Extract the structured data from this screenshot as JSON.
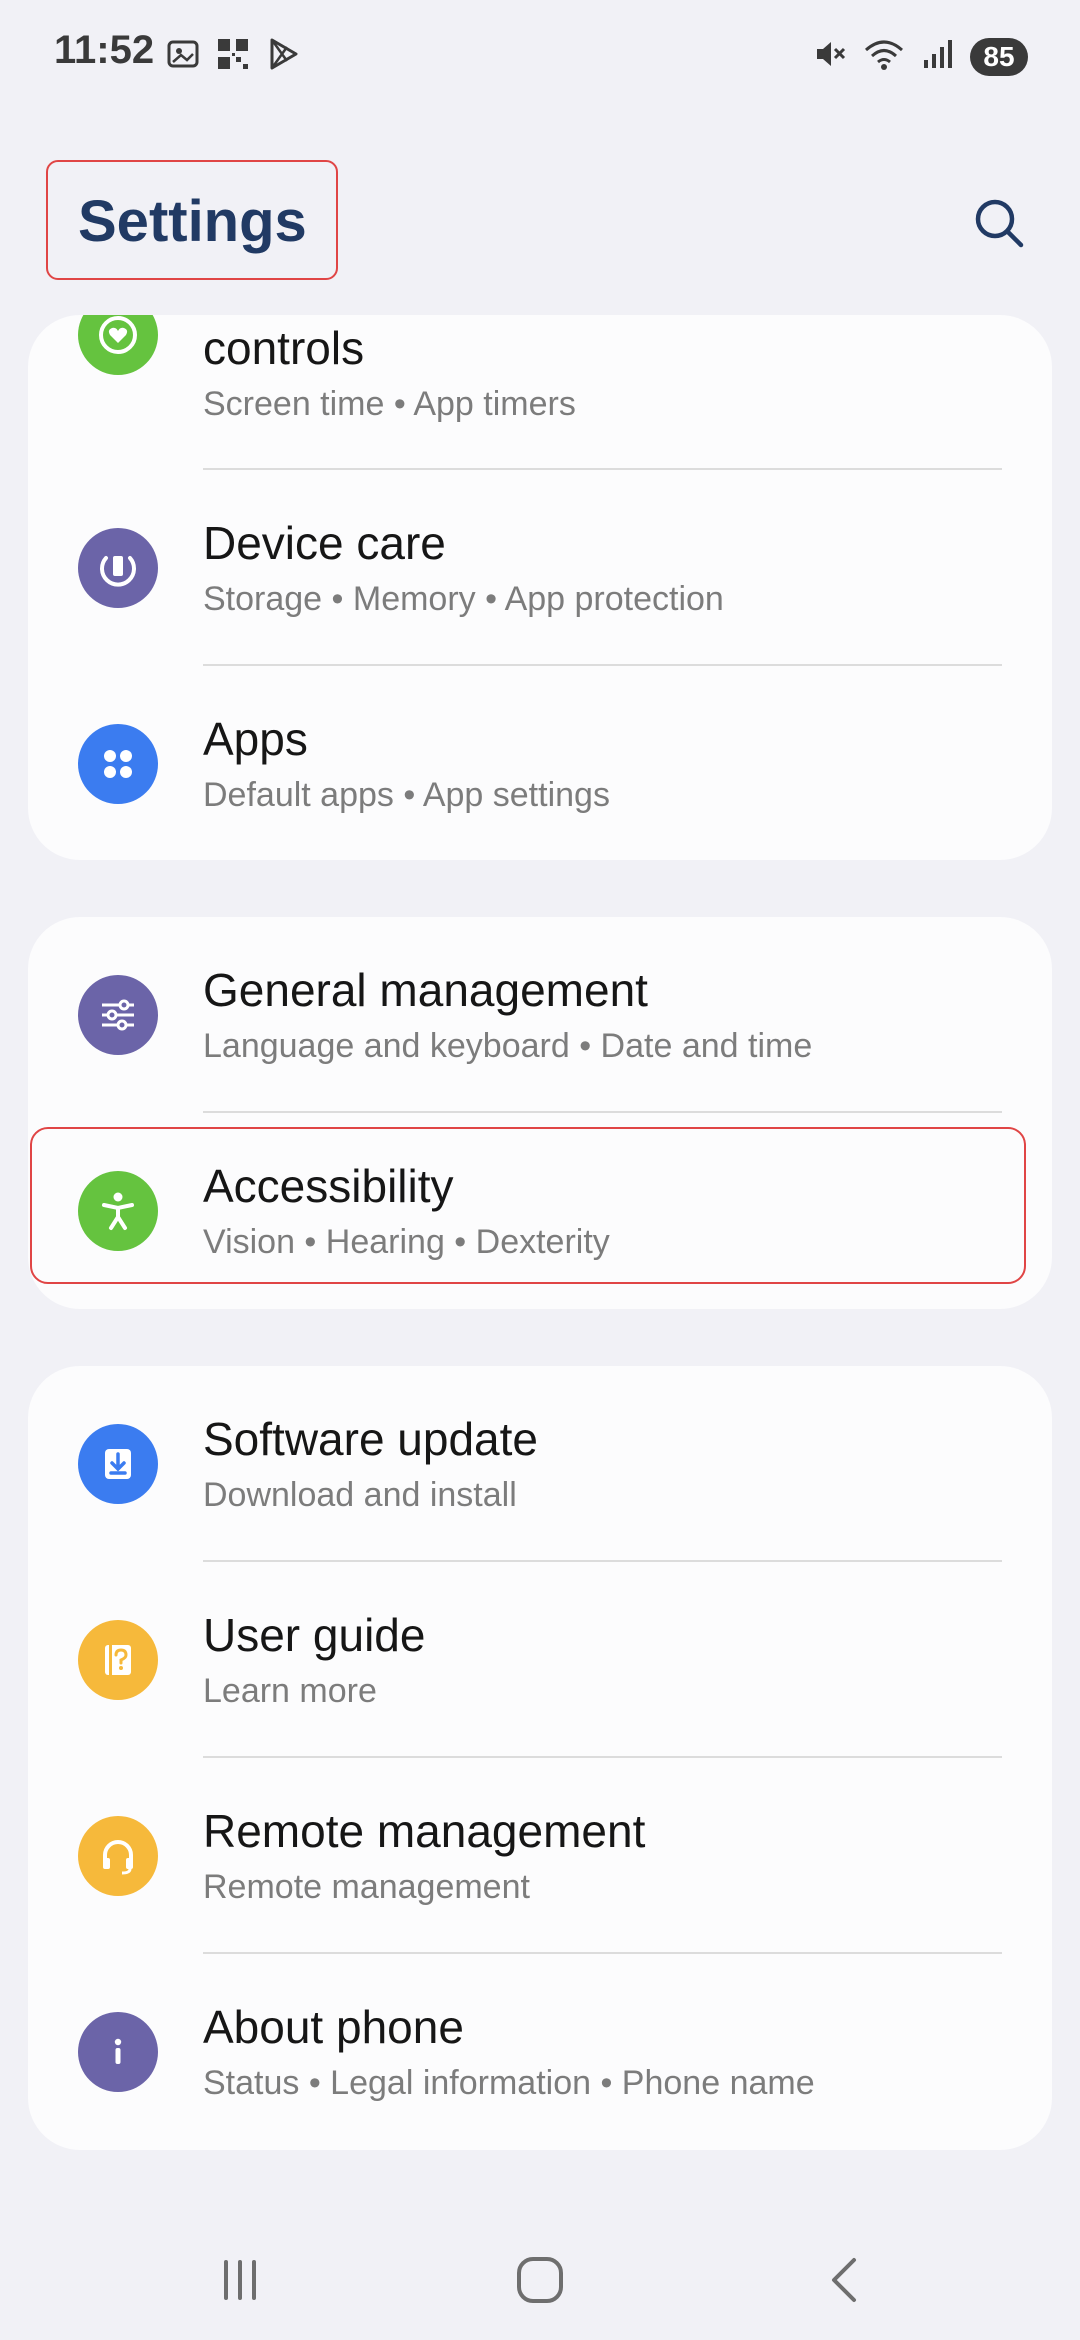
{
  "status_bar": {
    "time": "11:52",
    "battery": "85",
    "left_icons": [
      "screenshot-icon",
      "qr-icon",
      "play-store-icon"
    ],
    "right_icons": [
      "mute-icon",
      "wifi-icon",
      "signal-icon"
    ]
  },
  "header": {
    "title": "Settings",
    "search_icon": "search-icon"
  },
  "colors": {
    "background": "#f1f1f6",
    "card": "#fcfcfd",
    "title": "#213a64",
    "highlight": "#e04545",
    "green": "#65c33f",
    "purple": "#6b64a8",
    "blue": "#3b7cf0",
    "yellow": "#f6b93b"
  },
  "cards": [
    {
      "items": [
        {
          "label": "controls",
          "subs": [
            "Screen time",
            "App timers"
          ],
          "icon": "heart-icon"
        },
        {
          "label": "Device care",
          "subs": [
            "Storage",
            "Memory",
            "App protection"
          ],
          "icon": "device-care-icon"
        },
        {
          "label": "Apps",
          "subs": [
            "Default apps",
            "App settings"
          ],
          "icon": "apps-icon"
        }
      ]
    },
    {
      "items": [
        {
          "label": "General management",
          "subs": [
            "Language and keyboard",
            "Date and time"
          ],
          "icon": "sliders-icon"
        },
        {
          "label": "Accessibility",
          "subs": [
            "Vision",
            "Hearing",
            "Dexterity"
          ],
          "icon": "accessibility-icon"
        }
      ]
    },
    {
      "items": [
        {
          "label": "Software update",
          "subs": [
            "Download and install"
          ],
          "icon": "download-icon"
        },
        {
          "label": "User guide",
          "subs": [
            "Learn more"
          ],
          "icon": "guide-icon"
        },
        {
          "label": "Remote management",
          "subs": [
            "Remote management"
          ],
          "icon": "headset-icon"
        },
        {
          "label": "About phone",
          "subs": [
            "Status",
            "Legal information",
            "Phone name"
          ],
          "icon": "info-icon"
        }
      ]
    }
  ],
  "sub_joined": {
    "c0_0": "Screen time  •  App timers",
    "c0_1": "Storage  •  Memory  •  App protection",
    "c0_2": "Default apps  •  App settings",
    "c1_0": "Language and keyboard  •  Date and time",
    "c1_1": "Vision  •  Hearing  •  Dexterity",
    "c2_0": "Download and install",
    "c2_1": "Learn more",
    "c2_2": "Remote management",
    "c2_3": "Status  •  Legal information  •  Phone name"
  },
  "nav_bar": {
    "recents_icon": "recents-icon",
    "home_icon": "home-icon",
    "back_icon": "back-icon"
  }
}
